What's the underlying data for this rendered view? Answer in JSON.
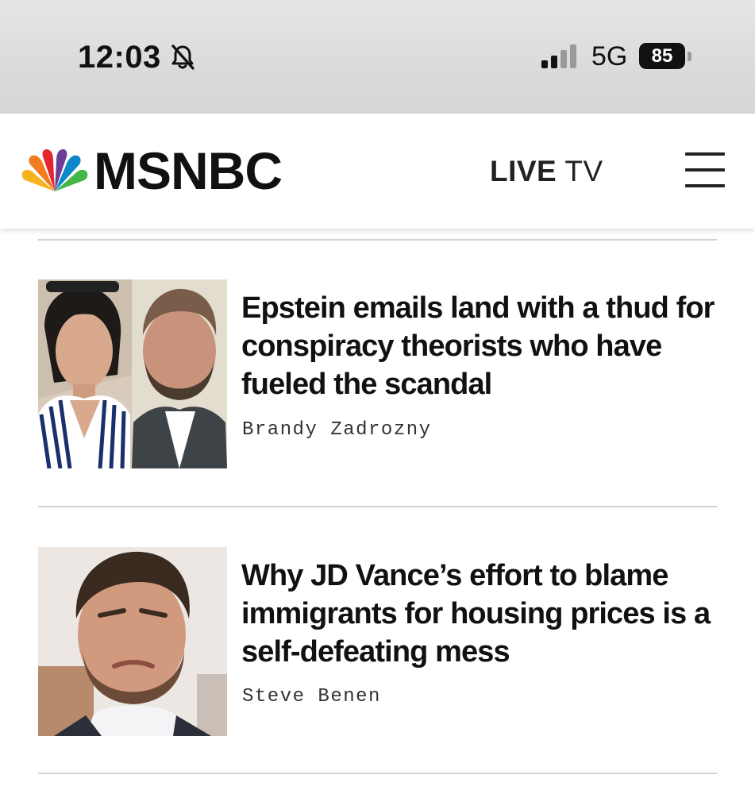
{
  "status_bar": {
    "time": "12:03",
    "network": "5G",
    "battery": "85",
    "icons": [
      "bell-slash-icon",
      "signal-bars-icon",
      "battery-icon"
    ]
  },
  "header": {
    "logo_text": "MSNBC",
    "live_label": "LIVE",
    "tv_label": "TV",
    "icons": [
      "peacock-logo-icon",
      "hamburger-menu-icon"
    ]
  },
  "articles": [
    {
      "headline": "Epstein emails land with a thud for conspiracy theorists who have fueled the scandal",
      "byline": "Brandy Zadrozny"
    },
    {
      "headline": "Why JD Vance’s effort to blame immigrants for housing prices is a self-defeating mess",
      "byline": "Steve Benen"
    }
  ],
  "colors": {
    "peacock": [
      "#f6b31c",
      "#f47b20",
      "#e4252d",
      "#6c3c97",
      "#0c87c9",
      "#42b649"
    ]
  }
}
